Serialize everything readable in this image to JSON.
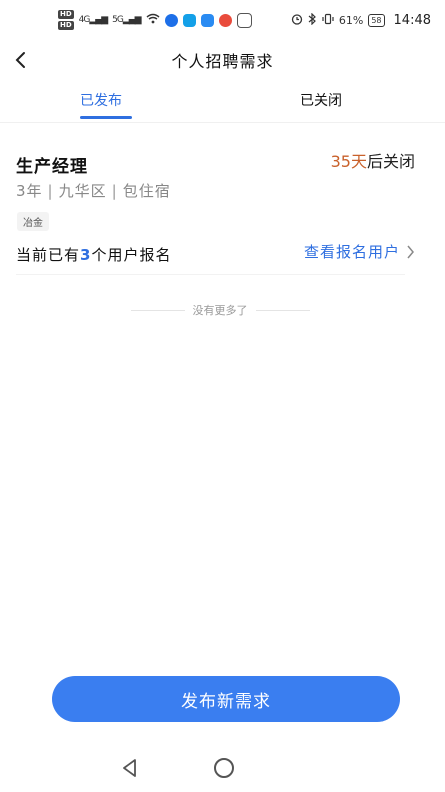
{
  "status_bar": {
    "hd1": "HD",
    "hd2": "HD",
    "signal1": "4G",
    "signal2": "5G",
    "battery_percent": "61%",
    "battery_icon_text": "58",
    "time": "14:48"
  },
  "header": {
    "title": "个人招聘需求"
  },
  "tabs": [
    {
      "label": "已发布",
      "active": true
    },
    {
      "label": "已关闭",
      "active": false
    }
  ],
  "job": {
    "title": "生产经理",
    "close_days": "35天",
    "close_suffix": "后关闭",
    "meta": [
      "3年",
      "九华区",
      "包住宿"
    ],
    "tag": "冶金",
    "applicants_prefix": "当前已有",
    "applicants_count": "3",
    "applicants_suffix": "个用户报名",
    "view_label": "查看报名用户"
  },
  "list_end_text": "没有更多了",
  "publish_button_label": "发布新需求",
  "colors": {
    "accent": "#2f6fe0",
    "button": "#3a7ef0",
    "days": "#c9612b"
  }
}
